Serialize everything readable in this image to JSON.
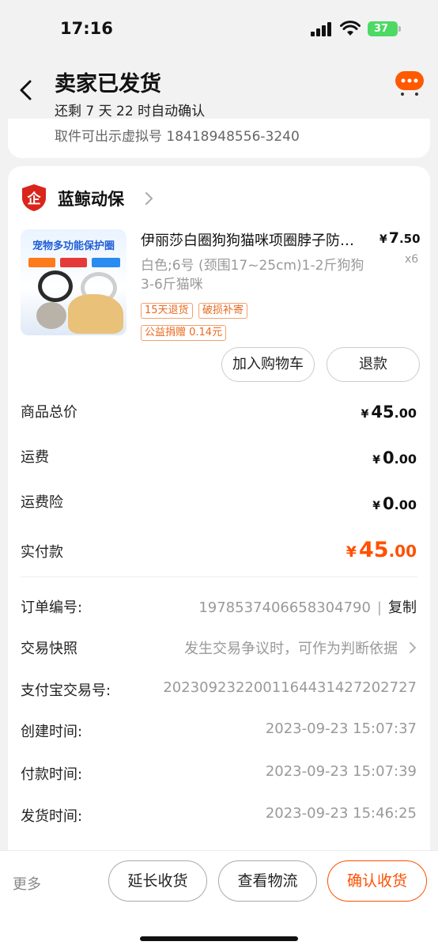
{
  "status_bar": {
    "time": "17:16",
    "battery": "37"
  },
  "header": {
    "title": "卖家已发货",
    "subtitle": "还剩 7 天 22 时自动确认",
    "back_icon": "chevron-left-icon",
    "chat_icon": "message-bubble-icon"
  },
  "pickup": {
    "text": "取件可出示虚拟号 18418948556-3240"
  },
  "shop": {
    "name": "蓝鲸动保",
    "icon": "enterprise-shield-icon"
  },
  "product": {
    "image_banner": "宠物多功能保护圈",
    "title": "伊丽莎白圈狗狗猫咪项圈脖子防咬防舔",
    "price_currency": "¥",
    "price_int": "7",
    "price_dec": ".50",
    "quantity": "x6",
    "spec": "白色;6号 (颈围17~25cm)1-2斤狗狗 3-6斤猫咪",
    "tags": [
      "15天退货",
      "破损补寄"
    ],
    "charity_tag": "公益捐赠 0.14元",
    "buttons": {
      "add_to_cart": "加入购物车",
      "refund": "退款"
    }
  },
  "costs": [
    {
      "label": "商品总价",
      "currency": "¥",
      "int": "45",
      "dec": ".00"
    },
    {
      "label": "运费",
      "currency": "¥",
      "int": "0",
      "dec": ".00"
    },
    {
      "label": "运费险",
      "currency": "¥",
      "int": "0",
      "dec": ".00"
    },
    {
      "label": "实付款",
      "currency": "¥",
      "int": "45",
      "dec": ".00"
    }
  ],
  "order_info": {
    "order_no": {
      "label": "订单编号:",
      "value": "1978537406658304790",
      "separator": "|",
      "copy": "复制"
    },
    "snapshot": {
      "label": "交易快照",
      "value": "发生交易争议时，可作为判断依据"
    },
    "alipay_no": {
      "label": "支付宝交易号:",
      "value": "2023092322001164431427202727"
    },
    "created": {
      "label": "创建时间:",
      "value": "2023-09-23 15:07:37"
    },
    "paid": {
      "label": "付款时间:",
      "value": "2023-09-23 15:07:39"
    },
    "shipped": {
      "label": "发货时间:",
      "value": "2023-09-23 15:46:25"
    }
  },
  "bottom_bar": {
    "more": "更多",
    "extend": "延长收货",
    "logistics": "查看物流",
    "confirm": "确认收货"
  },
  "colors": {
    "accent": "#ff5000",
    "tag": "#e86a20",
    "battery": "#4cd964",
    "shop_icon": "#d9251c"
  }
}
